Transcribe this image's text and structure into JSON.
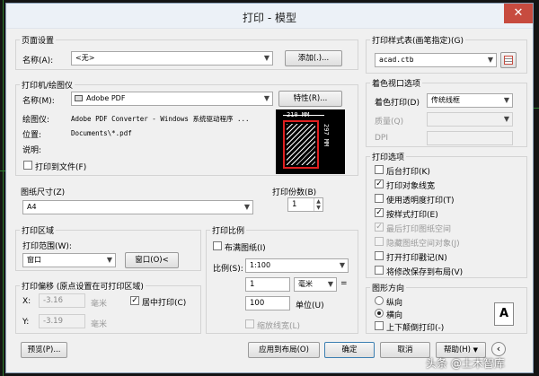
{
  "dialog": {
    "title": "打印 - 模型",
    "close_glyph": "✕"
  },
  "page_setup": {
    "group": "页面设置",
    "name_label": "名称(A):",
    "name_value": "<无>",
    "add_button": "添加(.)..."
  },
  "printer": {
    "group": "打印机/绘图仪",
    "name_label": "名称(M):",
    "name_value": "Adobe PDF",
    "properties_button": "特性(R)...",
    "plotter_label": "绘图仪:",
    "plotter_value": "Adobe PDF Converter - Windows 系统驱动程序 ...",
    "location_label": "位置:",
    "location_value": "Documents\\*.pdf",
    "desc_label": "说明:",
    "print_to_file": "打印到文件(F)",
    "preview_width": "210 MM",
    "preview_height": "297 MM"
  },
  "paper_size": {
    "group": "图纸尺寸(Z)",
    "value": "A4"
  },
  "copies": {
    "group": "打印份数(B)",
    "value": "1"
  },
  "plot_area": {
    "group": "打印区域",
    "range_label": "打印范围(W):",
    "range_value": "窗口",
    "window_button": "窗口(O)<"
  },
  "plot_scale": {
    "group": "打印比例",
    "fit_paper": "布满图纸(I)",
    "scale_label": "比例(S):",
    "scale_value": "1:100",
    "value1": "1",
    "unit1": "毫米",
    "equals": "=",
    "value2": "100",
    "unit2_label": "单位(U)",
    "scale_lineweights": "缩放线宽(L)"
  },
  "plot_offset": {
    "group": "打印偏移 (原点设置在可打印区域)",
    "x_label": "X:",
    "x_value": "-3.16",
    "x_unit": "毫米",
    "y_label": "Y:",
    "y_value": "-3.19",
    "y_unit": "毫米",
    "center_label": "居中打印(C)"
  },
  "plot_style": {
    "group": "打印样式表(画笔指定)(G)",
    "value": "acad.ctb"
  },
  "shaded_viewport": {
    "group": "着色视口选项",
    "shade_label": "着色打印(D)",
    "shade_value": "传统线框",
    "quality_label": "质量(Q)",
    "dpi_label": "DPI"
  },
  "plot_options": {
    "group": "打印选项",
    "items": [
      {
        "label": "后台打印(K)",
        "checked": false,
        "enabled": true
      },
      {
        "label": "打印对象线宽",
        "checked": true,
        "enabled": true
      },
      {
        "label": "使用透明度打印(T)",
        "checked": false,
        "enabled": true
      },
      {
        "label": "按样式打印(E)",
        "checked": true,
        "enabled": true
      },
      {
        "label": "最后打印图纸空间",
        "checked": true,
        "enabled": false
      },
      {
        "label": "隐藏图纸空间对象(J)",
        "checked": false,
        "enabled": false
      },
      {
        "label": "打开打印戳记(N)",
        "checked": false,
        "enabled": true
      },
      {
        "label": "将修改保存到布局(V)",
        "checked": false,
        "enabled": true
      }
    ]
  },
  "orientation": {
    "group": "图形方向",
    "portrait": "纵向",
    "landscape": "横向",
    "selected": "landscape",
    "upside_down": "上下颠倒打印(-)",
    "icon_letter": "A"
  },
  "footer": {
    "preview_button": "预览(P)...",
    "apply_button": "应用到布局(O)",
    "ok_button": "确定",
    "cancel_button": "取消",
    "help_button": "帮助(H)",
    "collapse_glyph": "‹"
  },
  "watermark": "头条 @土木智库",
  "colors": {
    "accent_red": "#c74b3f",
    "preview_red": "#e02020",
    "cad_green": "#2f7d2f"
  }
}
